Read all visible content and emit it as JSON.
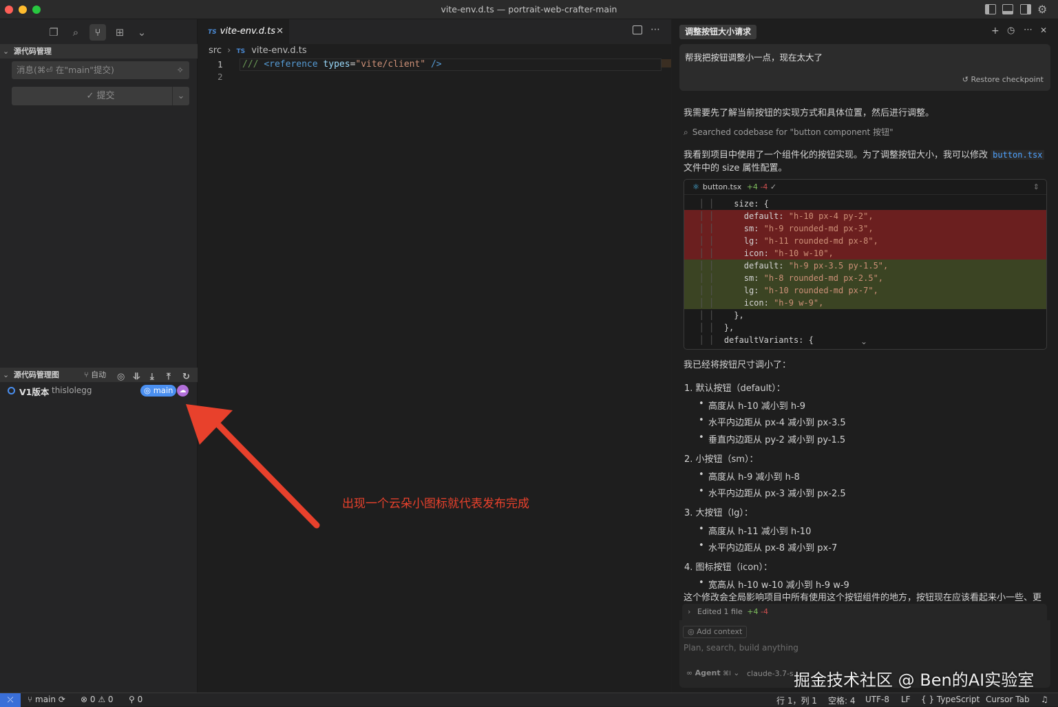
{
  "window": {
    "title": "vite-env.d.ts — portrait-web-crafter-main"
  },
  "sidebar": {
    "scm_section_title": "源代码管理",
    "commit_placeholder": "消息(⌘⏎ 在\"main\"提交)",
    "commit_button": "✓ 提交",
    "graph_section_title": "源代码管理图",
    "graph_auto_label": "自动",
    "graph_commit": {
      "message": "V1版本",
      "author": "thislolegg",
      "branch_badge": "main"
    }
  },
  "editor": {
    "tab_lang": "TS",
    "tab_label": "vite-env.d.ts",
    "breadcrumb": {
      "folder": "src",
      "lang": "TS",
      "file": "vite-env.d.ts"
    },
    "lines": [
      {
        "num": "1",
        "comment": "///",
        "tag": "<reference",
        "attr": "types",
        "eq": "=",
        "value": "\"vite/client\"",
        "end": "/>"
      },
      {
        "num": "2"
      }
    ]
  },
  "chat": {
    "title": "调整按钮大小请求",
    "user_message": "帮我把按钮调整小一点，现在太大了",
    "restore_checkpoint": "Restore checkpoint",
    "para1": "我需要先了解当前按钮的实现方式和具体位置，然后进行调整。",
    "search_status": "Searched codebase for \"button component 按钮\"",
    "para2_a": "我看到项目中使用了一个组件化的按钮实现。为了调整按钮大小，我可以修改",
    "para2_code": "button.tsx",
    "para2_b": "文件中的 size 属性配置。",
    "diff": {
      "file": "button.tsx",
      "added": "+4",
      "removed": "-4",
      "lines": [
        {
          "type": "ctx",
          "indent": "    ",
          "key": "size: {",
          "val": ""
        },
        {
          "type": "del",
          "indent": "      ",
          "key": "default: ",
          "val": "\"h-10 px-4 py-2\","
        },
        {
          "type": "del",
          "indent": "      ",
          "key": "sm: ",
          "val": "\"h-9 rounded-md px-3\","
        },
        {
          "type": "del",
          "indent": "      ",
          "key": "lg: ",
          "val": "\"h-11 rounded-md px-8\","
        },
        {
          "type": "del",
          "indent": "      ",
          "key": "icon: ",
          "val": "\"h-10 w-10\","
        },
        {
          "type": "add",
          "indent": "      ",
          "key": "default: ",
          "val": "\"h-9 px-3.5 py-1.5\","
        },
        {
          "type": "add",
          "indent": "      ",
          "key": "sm: ",
          "val": "\"h-8 rounded-md px-2.5\","
        },
        {
          "type": "add",
          "indent": "      ",
          "key": "lg: ",
          "val": "\"h-10 rounded-md px-7\","
        },
        {
          "type": "add",
          "indent": "      ",
          "key": "icon: ",
          "val": "\"h-9 w-9\","
        },
        {
          "type": "ctx",
          "indent": "    ",
          "key": "},",
          "val": ""
        },
        {
          "type": "ctx",
          "indent": "  ",
          "key": "},",
          "val": ""
        },
        {
          "type": "ctx",
          "indent": "  ",
          "key": "defaultVariants: {",
          "val": ""
        }
      ]
    },
    "summary_intro": "我已经将按钮尺寸调小了：",
    "items": [
      {
        "heading": "1. 默认按钮（default）：",
        "bullets": [
          "高度从 h-10 减小到 h-9",
          "水平内边距从 px-4 减小到 px-3.5",
          "垂直内边距从 py-2 减小到 py-1.5"
        ]
      },
      {
        "heading": "2. 小按钮（sm）：",
        "bullets": [
          "高度从 h-9 减小到 h-8",
          "水平内边距从 px-3 减小到 px-2.5"
        ]
      },
      {
        "heading": "3. 大按钮（lg）：",
        "bullets": [
          "高度从 h-11 减小到 h-10",
          "水平内边距从 px-8 减小到 px-7"
        ]
      },
      {
        "heading": "4. 图标按钮（icon）：",
        "bullets": [
          "宽高从 h-10 w-10 减小到 h-9 w-9"
        ]
      }
    ],
    "closing": "这个修改会全局影响项目中所有使用这个按钮组件的地方，按钮现在应该看起来小一些、更",
    "edited_files": {
      "label": "Edited 1 file",
      "added": "+4",
      "removed": "-4"
    },
    "composer": {
      "add_context": "Add context",
      "placeholder": "Plan, search, build anything",
      "mode": "Agent",
      "mode_shortcut": "⌘I",
      "model": "claude-3.7-s"
    }
  },
  "statusbar": {
    "branch": "main",
    "errors": "0",
    "warnings": "0",
    "ports": "0",
    "cursor": "行 1，列 1",
    "spaces": "空格: 4",
    "encoding": "UTF-8",
    "eol": "LF",
    "language": "TypeScript",
    "cursor_tab": "Cursor Tab"
  },
  "annotation": {
    "text": "出现一个云朵小图标就代表发布完成",
    "color": "#e8412c"
  },
  "watermark": "掘金技术社区 @ Ben的AI实验室",
  "colors": {
    "accent": "#4a8ff0",
    "deleted_bg": "#6b1f1f",
    "added_bg": "#3b4423",
    "annotation": "#e8412c"
  }
}
